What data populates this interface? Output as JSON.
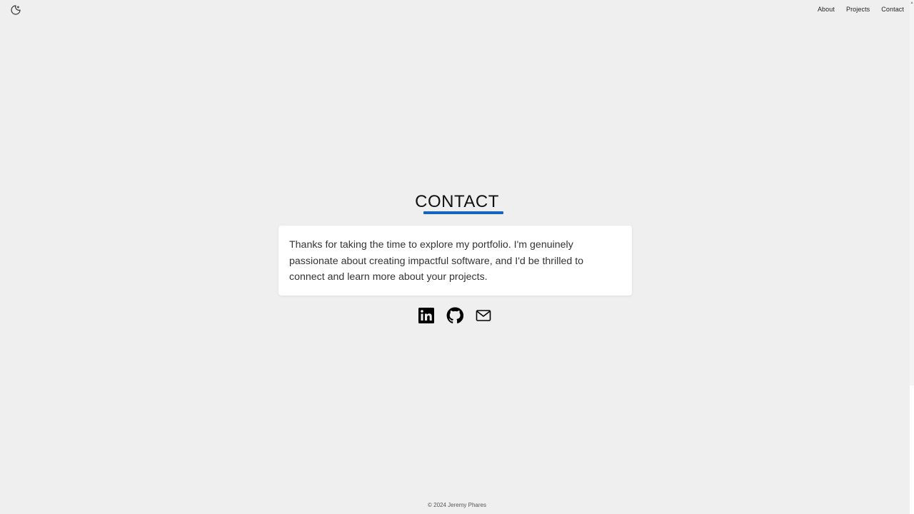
{
  "header": {
    "theme_toggle_icon": "moon-icon",
    "nav": [
      {
        "label": "About"
      },
      {
        "label": "Projects"
      },
      {
        "label": "Contact"
      }
    ]
  },
  "contact": {
    "title": "CONTACT",
    "accent_color": "#1565c0",
    "message": "Thanks for taking the time to explore my portfolio. I'm genuinely passionate about creating impactful software, and I'd be thrilled to connect and learn more about your projects.",
    "socials": [
      {
        "icon": "linkedin-icon"
      },
      {
        "icon": "github-icon"
      },
      {
        "icon": "mail-icon"
      }
    ]
  },
  "footer": {
    "text": "© 2024 Jeremy Phares"
  }
}
